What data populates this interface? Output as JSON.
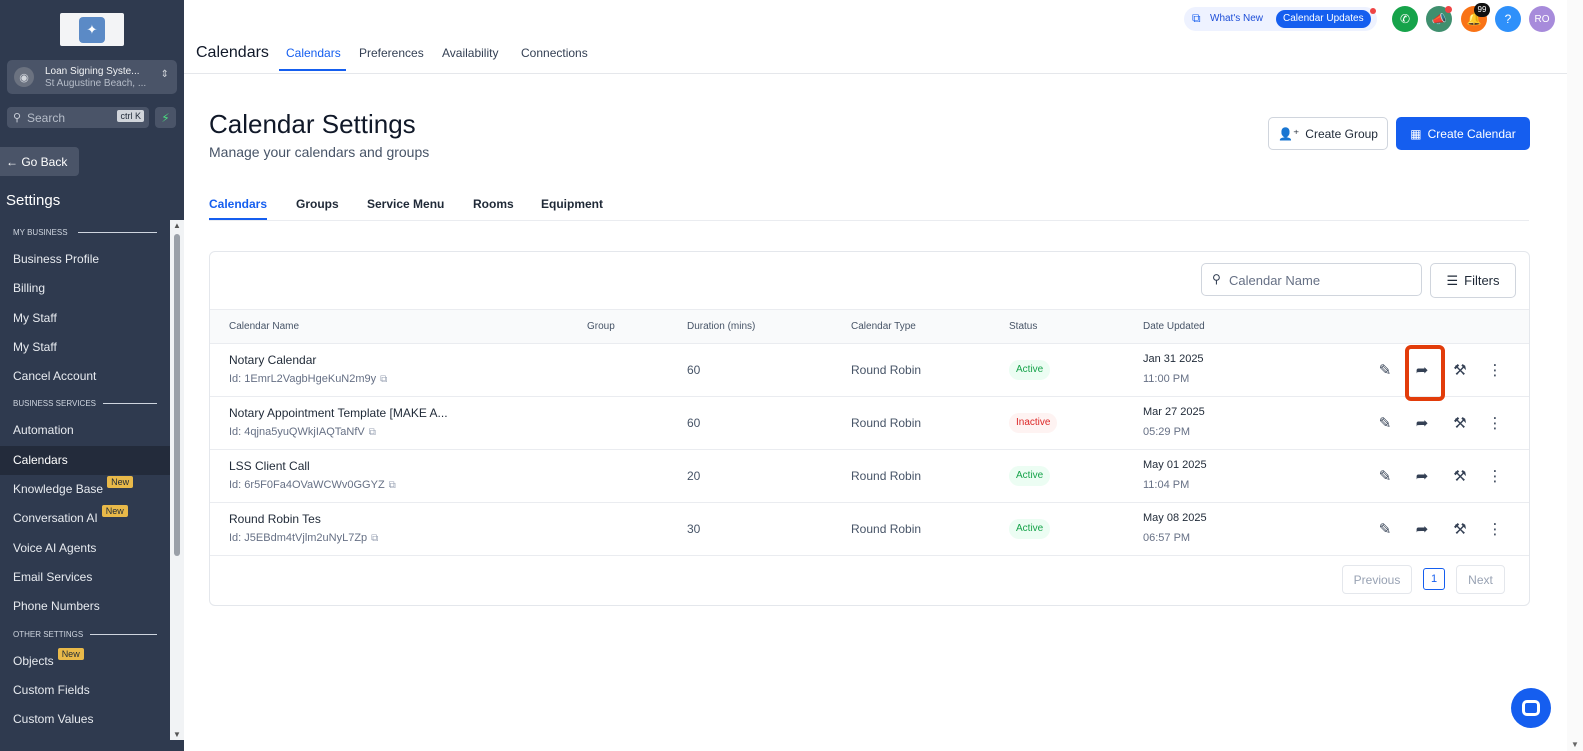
{
  "sidebar": {
    "account_name": "Loan Signing Syste...",
    "account_location": "St Augustine Beach, ...",
    "search_placeholder": "Search",
    "search_shortcut": "ctrl K",
    "go_back": "← Go Back",
    "settings_title": "Settings",
    "sections": [
      {
        "label": "MY BUSINESS",
        "items": [
          {
            "label": "Business Profile"
          },
          {
            "label": "Billing"
          },
          {
            "label": "My Staff"
          },
          {
            "label": "My Staff"
          },
          {
            "label": "Cancel Account"
          }
        ]
      },
      {
        "label": "BUSINESS SERVICES",
        "items": [
          {
            "label": "Automation"
          },
          {
            "label": "Calendars",
            "active": true
          },
          {
            "label": "Knowledge Base",
            "badge": "New"
          },
          {
            "label": "Conversation AI",
            "badge": "New"
          },
          {
            "label": "Voice AI Agents"
          },
          {
            "label": "Email Services"
          },
          {
            "label": "Phone Numbers"
          }
        ]
      },
      {
        "label": "OTHER SETTINGS",
        "items": [
          {
            "label": "Objects",
            "badge": "New"
          },
          {
            "label": "Custom Fields"
          },
          {
            "label": "Custom Values"
          }
        ]
      }
    ]
  },
  "topbar": {
    "title": "Calendars",
    "tabs": [
      "Calendars",
      "Preferences",
      "Availability",
      "Connections"
    ],
    "whats_new": "What's New",
    "calendar_updates": "Calendar Updates",
    "notification_count": "99",
    "help": "?",
    "user_initials": "RO",
    "colors": {
      "phone": "#16a34a",
      "megaphone": "#3f8f6e",
      "bell": "#f97316",
      "help": "#2e90fa",
      "avatar": "#a78bdb"
    }
  },
  "page": {
    "title": "Calendar Settings",
    "subtitle": "Manage your calendars and groups",
    "create_group": "Create Group",
    "create_calendar": "Create Calendar",
    "tabs": [
      "Calendars",
      "Groups",
      "Service Menu",
      "Rooms",
      "Equipment"
    ]
  },
  "table": {
    "search_placeholder": "Calendar Name",
    "filters": "Filters",
    "columns": [
      "Calendar Name",
      "Group",
      "Duration (mins)",
      "Calendar Type",
      "Status",
      "Date Updated"
    ],
    "rows": [
      {
        "name": "Notary Calendar",
        "id": "Id: 1EmrL2VagbHgeKuN2m9y",
        "duration": "60",
        "type": "Round Robin",
        "status": "Active",
        "date": "Jan 31 2025",
        "time": "11:00 PM"
      },
      {
        "name": "Notary Appointment Template [MAKE A...",
        "id": "Id: 4qjna5yuQWkjIAQTaNfV",
        "duration": "60",
        "type": "Round Robin",
        "status": "Inactive",
        "date": "Mar 27 2025",
        "time": "05:29 PM"
      },
      {
        "name": "LSS Client Call",
        "id": "Id: 6r5F0Fa4OVaWCWv0GGYZ",
        "duration": "20",
        "type": "Round Robin",
        "status": "Active",
        "date": "May 01 2025",
        "time": "11:04 PM"
      },
      {
        "name": "Round Robin Tes",
        "id": "Id: J5EBdm4tVjlm2uNyL7Zp",
        "duration": "30",
        "type": "Round Robin",
        "status": "Active",
        "date": "May 08 2025",
        "time": "06:57 PM"
      }
    ],
    "pagination": {
      "previous": "Previous",
      "page": "1",
      "next": "Next"
    }
  }
}
